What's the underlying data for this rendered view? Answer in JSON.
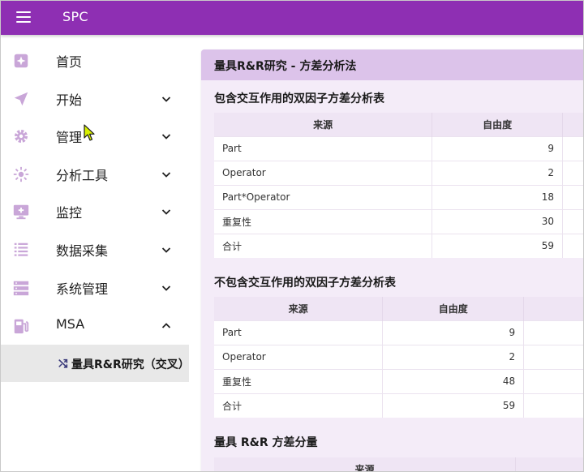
{
  "app": {
    "title": "SPC"
  },
  "sidebar": {
    "items": [
      {
        "label": "首页",
        "icon": "home-sparkle-icon",
        "chevron": ""
      },
      {
        "label": "开始",
        "icon": "send-icon",
        "chevron": "chevron-down"
      },
      {
        "label": "管理",
        "icon": "gear-icon",
        "chevron": "chevron-down"
      },
      {
        "label": "分析工具",
        "icon": "sun-icon",
        "chevron": "chevron-down"
      },
      {
        "label": "监控",
        "icon": "monitor-icon",
        "chevron": "chevron-down"
      },
      {
        "label": "数据采集",
        "icon": "checklist-icon",
        "chevron": "chevron-down"
      },
      {
        "label": "系统管理",
        "icon": "server-icon",
        "chevron": "chevron-down"
      },
      {
        "label": "MSA",
        "icon": "fuel-icon",
        "chevron": "chevron-up"
      }
    ],
    "sub_item": {
      "label": "量具R&R研究（交叉）",
      "icon": "shuffle-icon"
    }
  },
  "main": {
    "card_title": "量具R&R研究 - 方差分析法",
    "section1": {
      "title": "包含交互作用的双因子方差分析表",
      "headers": [
        "来源",
        "自由度"
      ],
      "rows": [
        {
          "source": "Part",
          "df": "9"
        },
        {
          "source": "Operator",
          "df": "2"
        },
        {
          "source": "Part*Operator",
          "df": "18"
        },
        {
          "source": "重复性",
          "df": "30"
        },
        {
          "source": "合计",
          "df": "59"
        }
      ]
    },
    "section2": {
      "title": "不包含交互作用的双因子方差分析表",
      "headers": [
        "来源",
        "自由度"
      ],
      "rows": [
        {
          "source": "Part",
          "df": "9"
        },
        {
          "source": "Operator",
          "df": "2"
        },
        {
          "source": "重复性",
          "df": "48"
        },
        {
          "source": "合计",
          "df": "59"
        }
      ]
    },
    "section3": {
      "title": "量具 R&R 方差分量",
      "headers": [
        "来源"
      ]
    }
  },
  "colors": {
    "appbar": "#8e2fb3",
    "card_header": "#dcc3ea",
    "card_bg": "#f4ecf8",
    "icon": "#c9a6d8",
    "selected_bg": "#e8e8e8"
  }
}
